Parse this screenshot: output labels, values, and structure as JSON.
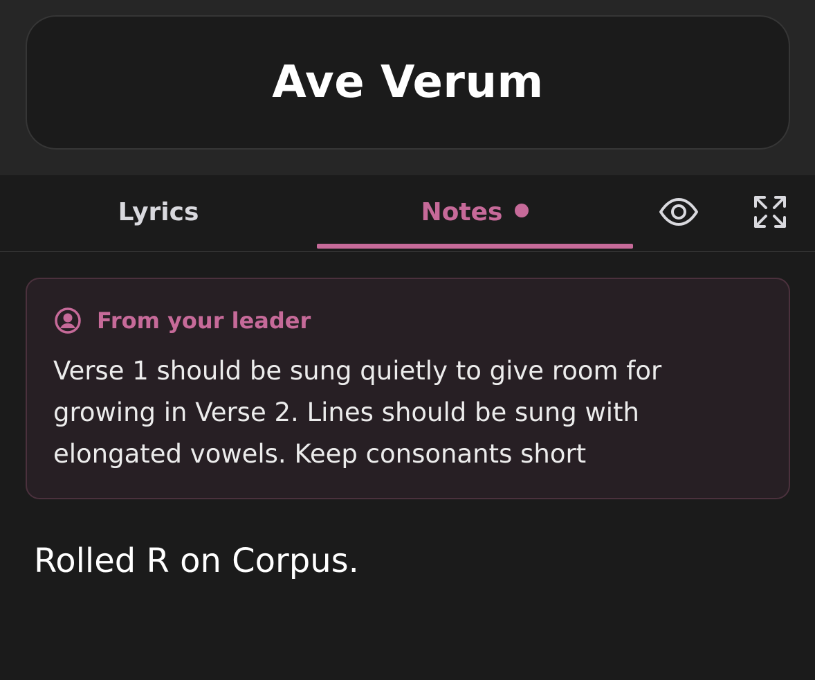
{
  "song": {
    "title": "Ave Verum"
  },
  "tabs": [
    {
      "label": "Lyrics",
      "active": false
    },
    {
      "label": "Notes",
      "active": true,
      "has_unread": true
    }
  ],
  "toolbar": {
    "visibility_icon": "eye-icon",
    "fullscreen_icon": "expand-icon"
  },
  "leader_note": {
    "heading": "From your leader",
    "icon": "person-circle-icon",
    "text": "Verse 1 should be sung quietly to give room for growing in Verse 2. Lines should be sung with elongated vowels. Keep consonants short"
  },
  "personal_note": {
    "text": "Rolled R on Corpus."
  },
  "colors": {
    "accent": "#c66a99",
    "background": "#1b1b1b",
    "header_background": "#262626",
    "note_card_background": "#271f24",
    "note_card_border": "#4b313d"
  }
}
